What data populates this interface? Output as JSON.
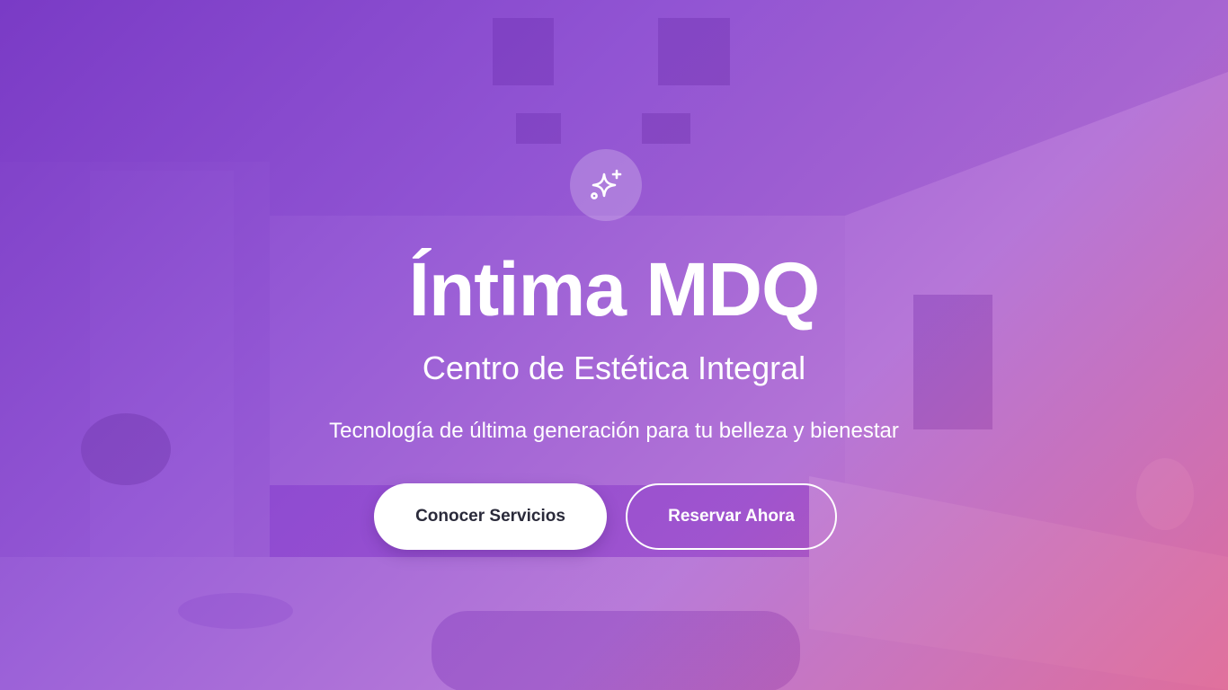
{
  "hero": {
    "icon": "sparkles-icon",
    "title": "Íntima MDQ",
    "subtitle": "Centro de Estética Integral",
    "tagline": "Tecnología de última generación para tu belleza y bienestar",
    "primary_button": "Conocer Servicios",
    "secondary_button": "Reservar Ahora"
  },
  "colors": {
    "overlay_start": "#7634c4",
    "overlay_end": "#de5c8c",
    "button_text": "#2a2a3a",
    "text": "#ffffff"
  }
}
